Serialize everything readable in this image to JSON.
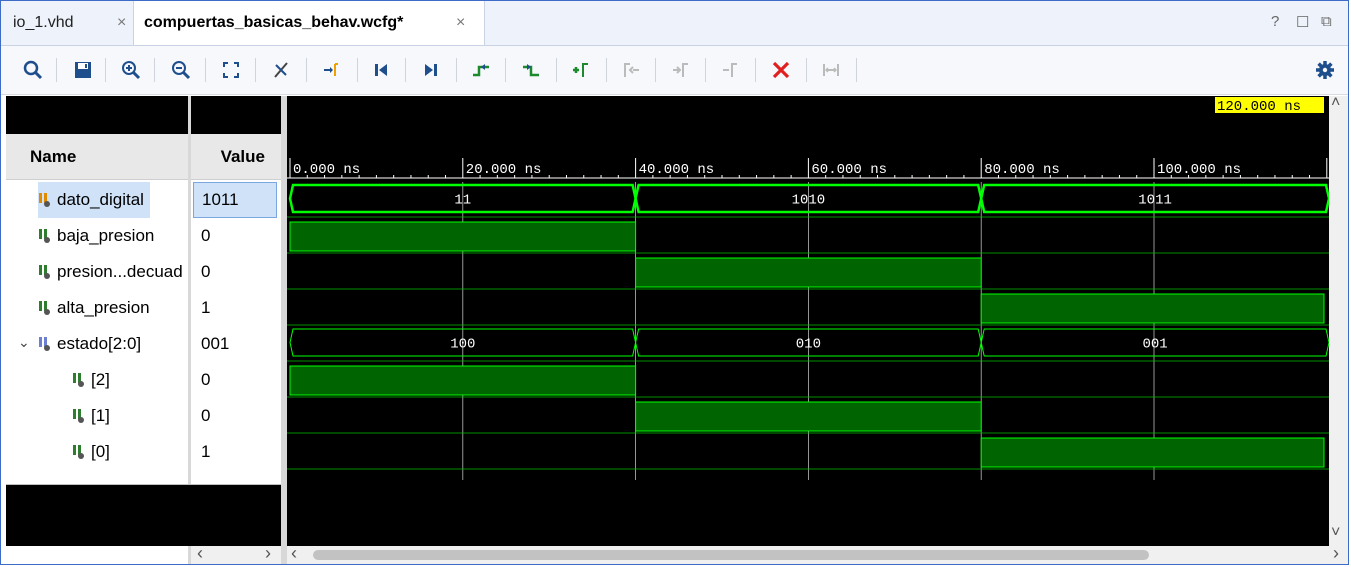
{
  "tabs": [
    {
      "label": "io_1.vhd",
      "close": "×"
    },
    {
      "label": "compuertas_basicas_behav.wcfg*",
      "close": "×"
    }
  ],
  "window_controls": {
    "help": "?",
    "restore": "☐",
    "float": "⧉"
  },
  "toolbar": {
    "buttons": [
      "search-icon",
      "save-icon",
      "zoom-in-icon",
      "zoom-out-icon",
      "zoom-fit-icon",
      "cursor-snap-icon",
      "go-to-cursor-icon",
      "go-to-start-icon",
      "go-to-end-icon",
      "previous-transition-icon",
      "next-transition-icon",
      "add-marker-icon",
      "previous-marker-icon",
      "next-marker-icon",
      "swap-cursors-icon",
      "delete-markers-icon",
      "fit-between-icon",
      "settings-icon"
    ]
  },
  "columns": {
    "name": "Name",
    "value": "Value"
  },
  "signals": [
    {
      "name": "dato_digital",
      "value": "1011",
      "type": "bus",
      "selected": true
    },
    {
      "name": "baja_presion",
      "value": "0",
      "type": "bit"
    },
    {
      "name": "presion...decuad",
      "value": "0",
      "type": "bit"
    },
    {
      "name": "alta_presion",
      "value": "1",
      "type": "bit"
    },
    {
      "name": "estado[2:0]",
      "value": "001",
      "type": "group",
      "expanded": true
    },
    {
      "name": "[2]",
      "value": "0",
      "type": "bit",
      "indent": true
    },
    {
      "name": "[1]",
      "value": "0",
      "type": "bit",
      "indent": true
    },
    {
      "name": "[0]",
      "value": "1",
      "type": "bit",
      "indent": true
    }
  ],
  "cursor_label": "120.000 ns",
  "timeline": {
    "ticks": [
      "0.000 ns",
      "20.000 ns",
      "40.000 ns",
      "60.000 ns",
      "80.000 ns",
      "100.000 ns"
    ],
    "bus_dato_digital": [
      "11",
      "1010",
      "1011"
    ],
    "bus_estado": [
      "100",
      "010",
      "001"
    ]
  },
  "colors": {
    "wave": "#00ff00",
    "fill": "#006400",
    "cursor_bg": "#ffff00",
    "grid": "#ffffff"
  }
}
